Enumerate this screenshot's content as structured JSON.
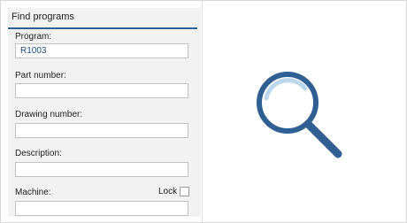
{
  "panel": {
    "title": "Find programs",
    "fields": {
      "program": {
        "label": "Program:",
        "value": "R1003"
      },
      "part_number": {
        "label": "Part number:",
        "value": ""
      },
      "drawing_number": {
        "label": "Drawing number:",
        "value": ""
      },
      "description": {
        "label": "Description:",
        "value": ""
      },
      "machine": {
        "label": "Machine:",
        "value": ""
      }
    },
    "lock": {
      "label": "Lock",
      "checked": false
    }
  },
  "icons": {
    "main": "magnifier-icon"
  },
  "colors": {
    "accent": "#2f5f93",
    "value_text": "#1a4c80"
  }
}
